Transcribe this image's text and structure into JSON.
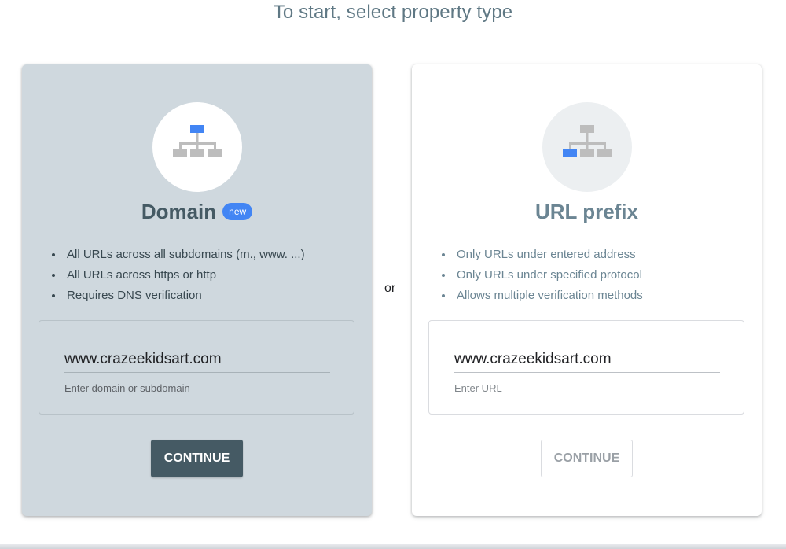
{
  "page": {
    "title": "To start, select property type"
  },
  "separator": "or",
  "domain_card": {
    "icon": "sitemap-top-highlighted-icon",
    "title": "Domain",
    "badge": "new",
    "features": [
      "All URLs across all subdomains (m., www. ...)",
      "All URLs across https or http",
      "Requires DNS verification"
    ],
    "input": {
      "value": "www.crazeekidsart.com",
      "hint": "Enter domain or subdomain"
    },
    "continue_label": "CONTINUE",
    "selected": true
  },
  "url_card": {
    "icon": "sitemap-leaf-highlighted-icon",
    "title": "URL prefix",
    "features": [
      "Only URLs under entered address",
      "Only URLs under specified protocol",
      "Allows multiple verification methods"
    ],
    "input": {
      "value": "www.crazeekidsart.com",
      "hint": "Enter URL"
    },
    "continue_label": "CONTINUE",
    "continue_enabled": false
  },
  "colors": {
    "accent_blue": "#4285f4",
    "selected_card_bg": "#cfd8de",
    "primary_button": "#455a64",
    "title_text": "#5f7884"
  }
}
